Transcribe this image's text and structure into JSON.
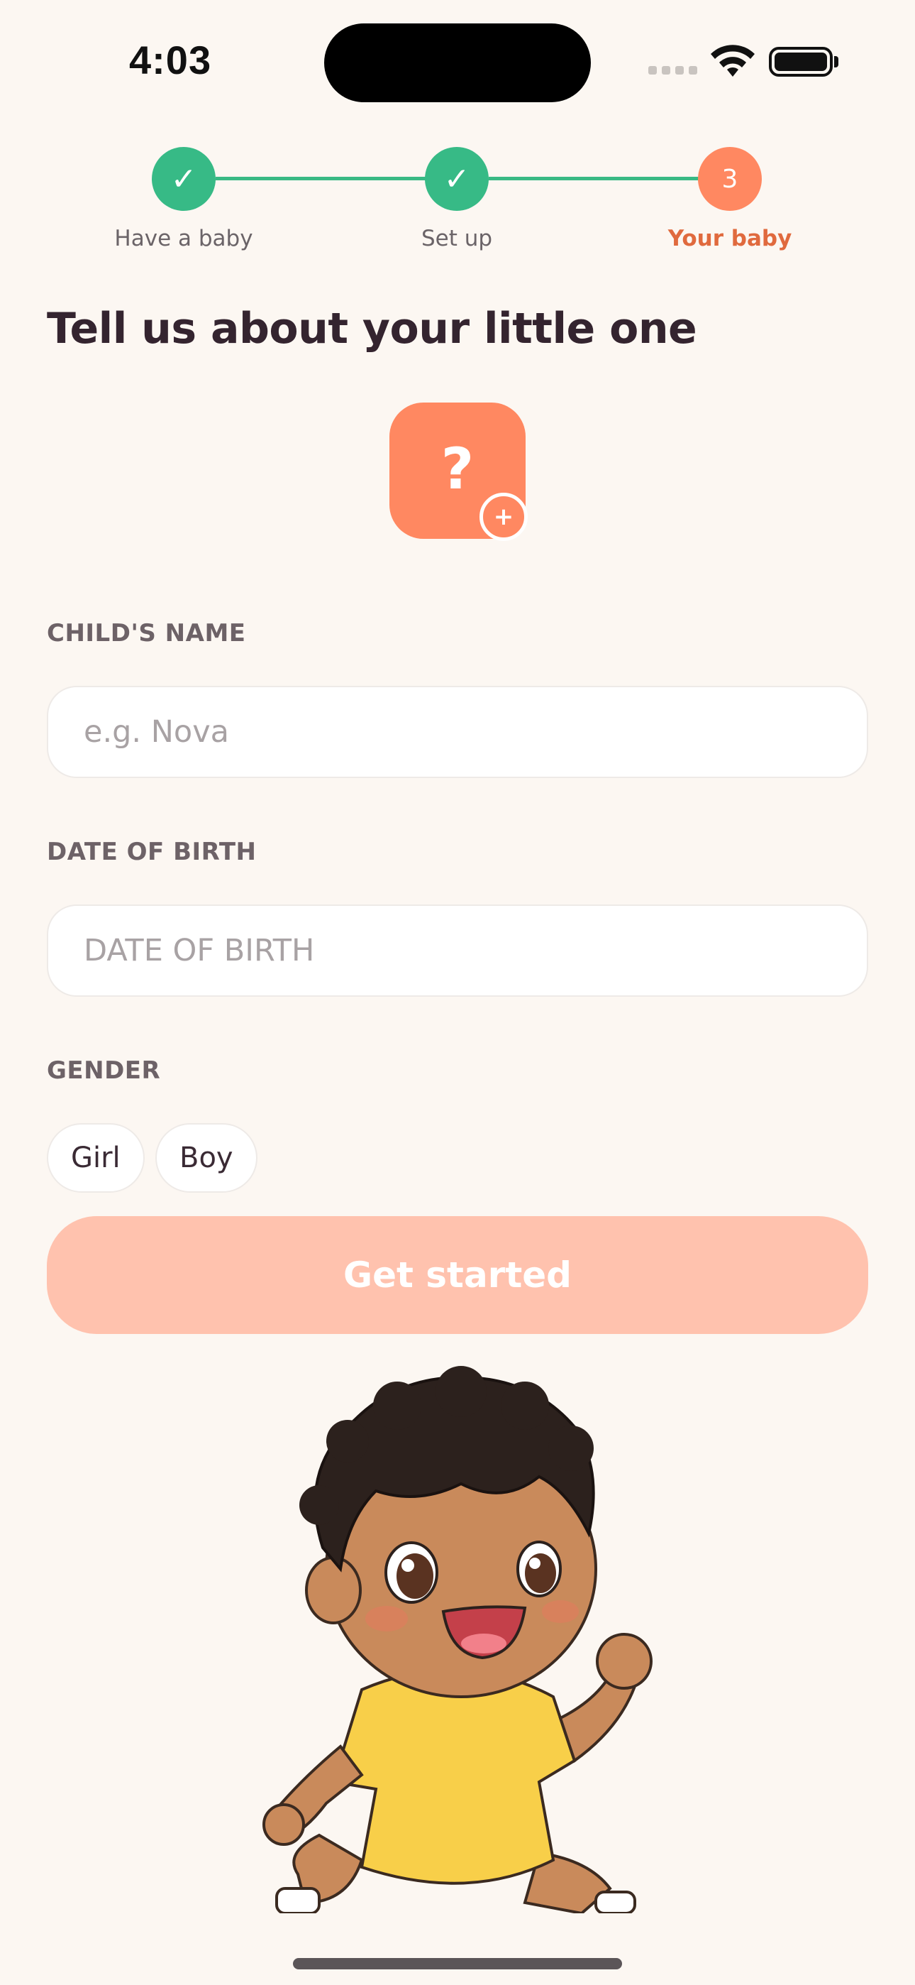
{
  "status_bar": {
    "time": "4:03"
  },
  "stepper": {
    "steps": [
      {
        "label": "Have a baby",
        "state": "done",
        "marker": "✓"
      },
      {
        "label": "Set up",
        "state": "done",
        "marker": "✓"
      },
      {
        "label": "Your baby",
        "state": "active",
        "marker": "3"
      }
    ]
  },
  "page": {
    "title": "Tell us about your little one"
  },
  "avatar": {
    "symbol": "?",
    "add_symbol": "+"
  },
  "form": {
    "name": {
      "label": "CHILD'S NAME",
      "placeholder": "e.g. Nova",
      "value": ""
    },
    "dob": {
      "label": "DATE OF BIRTH",
      "placeholder": "DATE OF BIRTH",
      "value": ""
    },
    "gender": {
      "label": "GENDER",
      "options": [
        "Girl",
        "Boy"
      ]
    }
  },
  "cta": {
    "label": "Get started"
  },
  "colors": {
    "accent": "#ff8861",
    "success": "#37ba86",
    "cta_disabled": "#ffc2ae",
    "background": "#fcf7f2"
  }
}
